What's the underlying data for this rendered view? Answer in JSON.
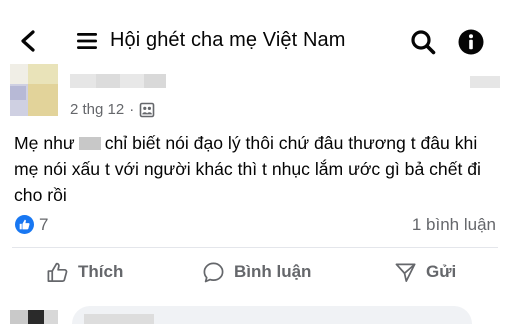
{
  "topbar": {
    "back_icon": "chevron-left-icon",
    "menu_icon": "menu-icon",
    "title": "Hội ghét cha mẹ Việt Nam",
    "search_icon": "search-icon",
    "info_icon": "info-icon"
  },
  "post": {
    "date": "2 thg 12",
    "separator": "·",
    "privacy_icon": "group-privacy-icon",
    "text_before_redaction": "Mẹ như",
    "text_after_redaction": "chỉ biết nói đạo lý thôi chứ đâu thương t đâu khi mẹ nói xấu t với người khác thì t nhục lắm ước gì bả chết đi cho rồi",
    "reactions": {
      "icon": "like-icon",
      "count": "7",
      "comments": "1 bình luận"
    },
    "actions": {
      "like_label": "Thích",
      "comment_label": "Bình luận",
      "send_label": "Gửi"
    }
  },
  "colors": {
    "accent": "#1877f2",
    "secondary_text": "#65676b",
    "primary_text": "#050505",
    "divider": "#e4e6eb"
  }
}
